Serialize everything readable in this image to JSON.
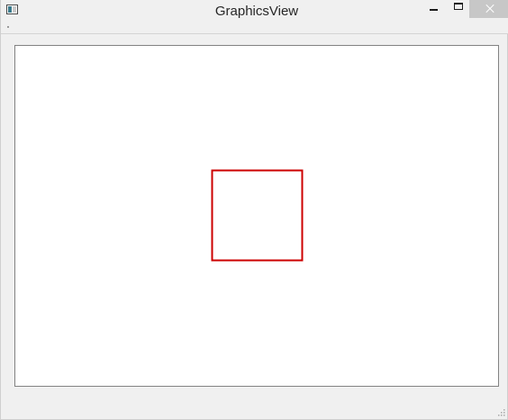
{
  "window": {
    "title": "GraphicsView"
  },
  "titlebar": {
    "app_icon": "application-icon",
    "minimize_icon": "minimize-icon",
    "maximize_icon": "maximize-icon",
    "close_icon": "close-icon",
    "close_hover_color": "#c7c7c7"
  },
  "scene": {
    "items": [
      {
        "type": "rect",
        "stroke": "#cc0000"
      }
    ]
  },
  "statusbar": {
    "grip_icon": "size-grip-icon"
  }
}
